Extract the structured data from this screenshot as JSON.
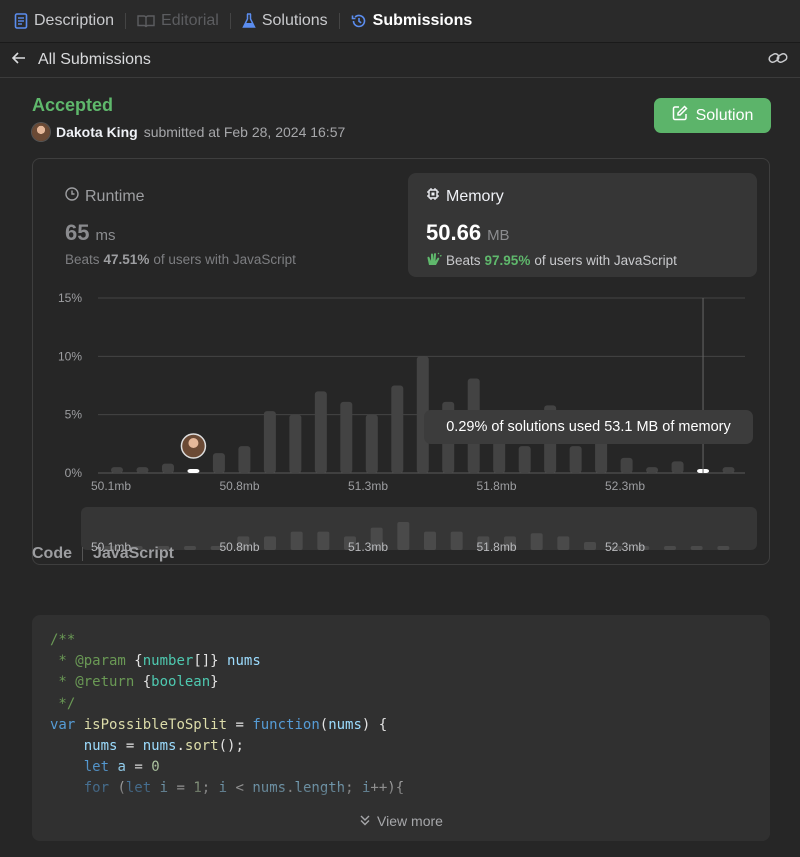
{
  "tabs": [
    {
      "label": "Description",
      "icon": "document-icon"
    },
    {
      "label": "Editorial",
      "icon": "book-icon"
    },
    {
      "label": "Solutions",
      "icon": "flask-icon"
    },
    {
      "label": "Submissions",
      "icon": "history-icon"
    }
  ],
  "subheader": {
    "back_label": "All Submissions"
  },
  "submission": {
    "status": "Accepted",
    "user": "Dakota King",
    "submitted_text": "submitted at Feb 28, 2024 16:57",
    "solution_button": "Solution"
  },
  "runtime": {
    "title": "Runtime",
    "value": "65",
    "unit": "ms",
    "beats_prefix": "Beats",
    "beats_value": "47.51%",
    "beats_suffix": "of users with JavaScript"
  },
  "memory": {
    "title": "Memory",
    "value": "50.66",
    "unit": "MB",
    "beats_prefix": "Beats",
    "beats_value": "97.95%",
    "beats_suffix": "of users with JavaScript"
  },
  "tooltip": "0.29% of solutions used 53.1 MB of memory",
  "chart_data": {
    "type": "bar",
    "y_ticks": [
      "15%",
      "10%",
      "5%",
      "0%"
    ],
    "ylim": [
      0,
      15
    ],
    "x_tick_labels": [
      "50.1mb",
      "50.8mb",
      "51.3mb",
      "51.8mb",
      "52.3mb"
    ],
    "values": [
      0.5,
      0.5,
      0.8,
      0.3,
      1.7,
      2.3,
      5.3,
      5.0,
      7.0,
      6.1,
      5.0,
      7.5,
      10.0,
      6.1,
      8.1,
      3.0,
      2.3,
      5.8,
      2.3,
      4.2,
      1.3,
      0.5,
      1.0,
      0.3,
      0.5
    ],
    "user_bar_index": 3,
    "highlight_bar_index": 23,
    "overview_values": [
      0.5,
      0.5,
      0.5,
      0.5,
      0.5,
      1.7,
      1.7,
      2.3,
      2.3,
      1.7,
      2.8,
      3.5,
      2.3,
      2.3,
      1.7,
      1.7,
      2.1,
      1.7,
      1.0,
      0.5,
      0.5,
      0.5,
      0.5,
      0.5
    ],
    "overview_tick_labels": [
      "50.1mb",
      "50.8mb",
      "51.3mb",
      "51.8mb",
      "52.3mb"
    ]
  },
  "code": {
    "label": "Code",
    "language": "JavaScript",
    "view_more": "View more"
  }
}
